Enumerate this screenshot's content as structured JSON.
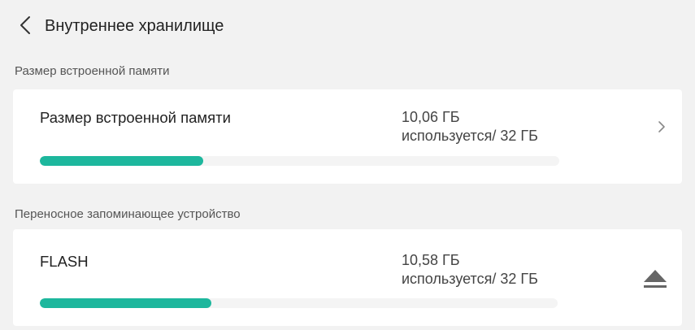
{
  "header": {
    "title": "Внутреннее хранилище",
    "back_icon": "chevron-left-icon"
  },
  "internal_section": {
    "header": "Размер встроенной памяти",
    "card": {
      "name": "Размер встроенной памяти",
      "used": "10,06 ГБ",
      "used_suffix": "используется/ 32 ГБ",
      "usage_fraction": 0.314,
      "action_icon": "chevron-right-icon"
    }
  },
  "portable_section": {
    "header": "Переносное запоминающее устройство",
    "card": {
      "name": "FLASH",
      "used": "10,58 ГБ",
      "used_suffix": "используется/ 32 ГБ",
      "usage_fraction": 0.331,
      "action_icon": "eject-icon"
    }
  },
  "colors": {
    "accent": "#1db79d",
    "background": "#f2f2f2",
    "card": "#ffffff",
    "track": "#f4f4f4"
  }
}
